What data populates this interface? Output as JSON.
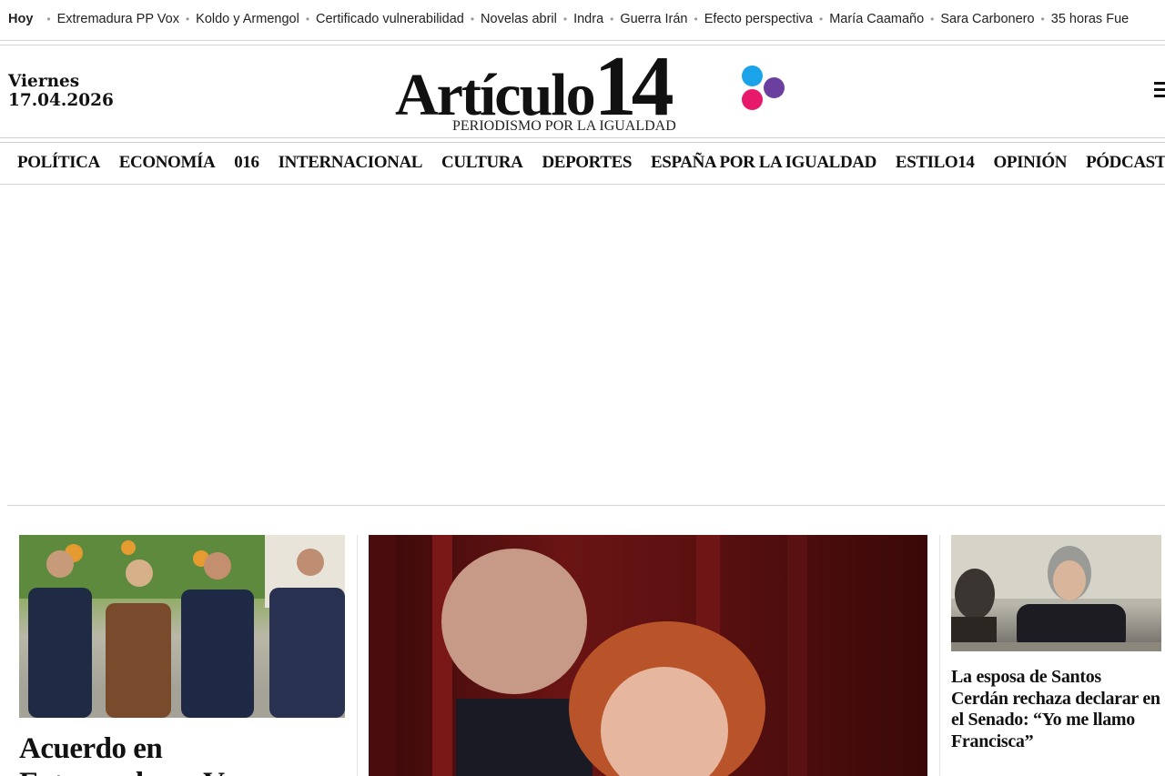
{
  "trending": {
    "label": "Hoy",
    "links": [
      "Extremadura PP Vox",
      "Koldo y Armengol",
      "Certificado vulnerabilidad",
      "Novelas abril",
      "Indra",
      "Guerra Irán",
      "Efecto perspectiva",
      "María Caamaño",
      "Sara Carbonero",
      "35 horas Fue"
    ]
  },
  "header": {
    "weekday": "Viernes",
    "date": "17.04.2026",
    "logo_word": "Artículo",
    "logo_number": "14",
    "tagline": "PERIODISMO POR LA IGUALDAD",
    "colors": {
      "blue": "#1aa3e8",
      "purple": "#6a3fa0",
      "pink": "#e6196b"
    }
  },
  "nav": {
    "items": [
      "POLÍTICA",
      "ECONOMÍA",
      "016",
      "INTERNACIONAL",
      "CULTURA",
      "DEPORTES",
      "ESPAÑA POR LA IGUALDAD",
      "ESTILO14",
      "OPINIÓN",
      "PÓDCAST"
    ]
  },
  "articles": {
    "left": {
      "headline": "Acuerdo en Extremadura: Vox"
    },
    "right": {
      "headline": "La esposa de Santos Cerdán rechaza declarar en el Senado: “Yo me llamo Francisca”"
    }
  }
}
